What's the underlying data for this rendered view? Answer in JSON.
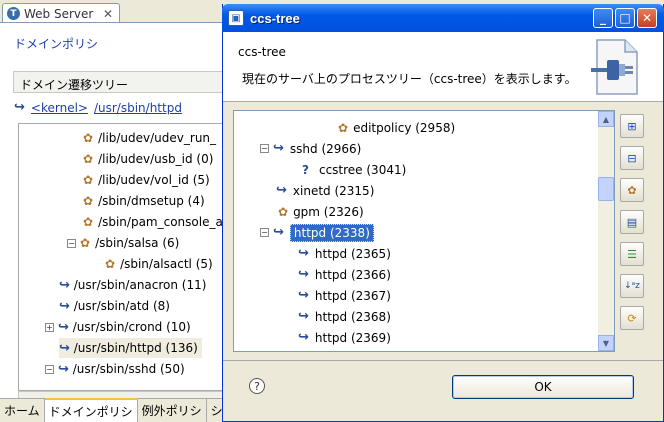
{
  "background_view": {
    "tab_title": "Web Server",
    "tab_close": "✕",
    "tab_icon": "T",
    "section_link": "ドメインポリシ",
    "section_title": "ドメイン遷移ツリー",
    "path": {
      "kernel": "<kernel>",
      "program": "/usr/sbin/httpd"
    },
    "tree_rows": [
      {
        "label": "/lib/udev/udev_run_",
        "icon": "gear-icon"
      },
      {
        "label": "/lib/udev/usb_id (0)",
        "icon": "gear-icon"
      },
      {
        "label": "/lib/udev/vol_id (5)",
        "icon": "gear-icon"
      },
      {
        "label": "/sbin/dmsetup (4)",
        "icon": "gear-icon"
      },
      {
        "label": "/sbin/pam_console_a",
        "icon": "gear-icon"
      },
      {
        "label": "/sbin/salsa (6)",
        "icon": "gear-icon"
      },
      {
        "label": "/sbin/alsactl (5)",
        "icon": "gear-icon"
      },
      {
        "label": "/usr/sbin/anacron (11)",
        "icon": "arrow-icon"
      },
      {
        "label": "/usr/sbin/atd (8)",
        "icon": "arrow-icon"
      },
      {
        "label": "/usr/sbin/crond (10)",
        "icon": "arrow-icon"
      },
      {
        "label": "/usr/sbin/httpd (136)",
        "icon": "arrow-icon"
      },
      {
        "label": "/usr/sbin/sshd (50)",
        "icon": "arrow-icon"
      }
    ],
    "bottom_tabs": [
      "ホーム",
      "ドメインポリシ",
      "例外ポリシ",
      "シ"
    ]
  },
  "dialog": {
    "title": "ccs-tree",
    "header_title": "ccs-tree",
    "header_description": "現在のサーバ上のプロセスツリー（ccs-tree）を表示します。",
    "ok_label": "OK",
    "help_label": "?",
    "tree": [
      {
        "label": "editpolicy (2958)",
        "icon": "gear-icon"
      },
      {
        "label": "sshd (2966)",
        "icon": "arrow-icon"
      },
      {
        "label": "ccstree (3041)",
        "icon": "question-icon"
      },
      {
        "label": "xinetd (2315)",
        "icon": "arrow-icon"
      },
      {
        "label": "gpm (2326)",
        "icon": "gear-icon"
      },
      {
        "label": "httpd (2338)",
        "icon": "arrow-icon",
        "selected": true
      },
      {
        "label": "httpd (2365)",
        "icon": "arrow-icon"
      },
      {
        "label": "httpd (2366)",
        "icon": "arrow-icon"
      },
      {
        "label": "httpd (2367)",
        "icon": "arrow-icon"
      },
      {
        "label": "httpd (2368)",
        "icon": "arrow-icon"
      },
      {
        "label": "httpd (2369)",
        "icon": "arrow-icon"
      }
    ],
    "toolbar": [
      {
        "name": "expand-all-button",
        "glyph": "⊞"
      },
      {
        "name": "collapse-all-button",
        "glyph": "⊟"
      },
      {
        "name": "process-button",
        "glyph": "✿"
      },
      {
        "name": "binary-button",
        "glyph": "▤"
      },
      {
        "name": "list-button",
        "glyph": "☰"
      },
      {
        "name": "sort-button",
        "glyph": "↓ᵃz"
      },
      {
        "name": "refresh-button",
        "glyph": "⟳"
      }
    ]
  },
  "colors": {
    "selection": "#316ac5",
    "title_bar": "#0058e6",
    "link": "#1c3fae"
  }
}
